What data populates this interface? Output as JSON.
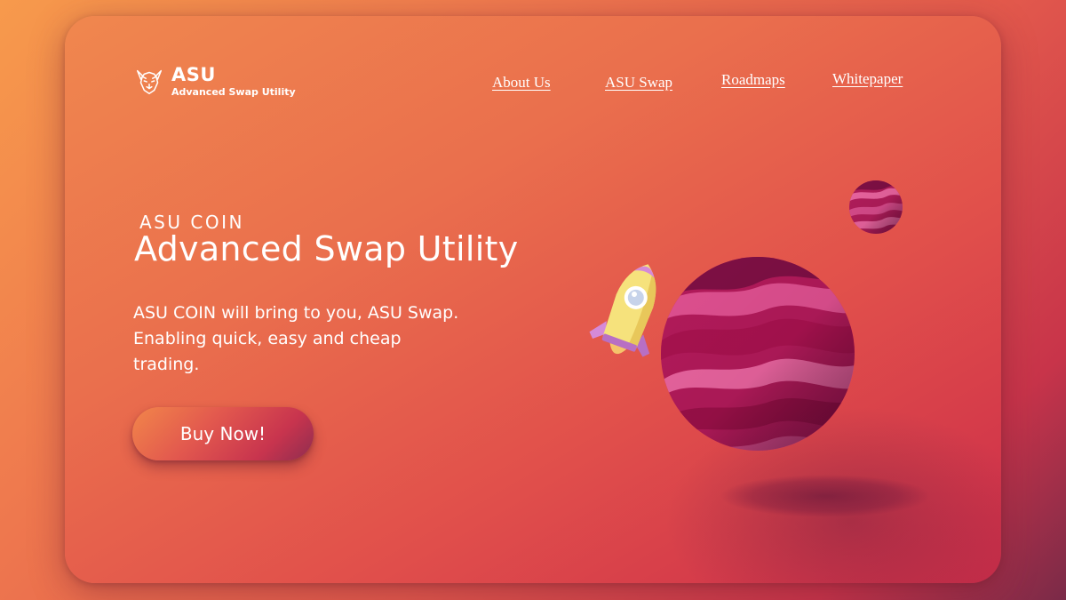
{
  "brand": {
    "name": "ASU",
    "tagline": "Advanced Swap Utility",
    "logo_icon": "dog-face-icon"
  },
  "nav": [
    {
      "label": "About Us"
    },
    {
      "label": "ASU Swap"
    },
    {
      "label": "Roadmaps"
    },
    {
      "label": "Whitepaper"
    }
  ],
  "hero": {
    "kicker": "ASU COIN",
    "title": "Advanced Swap Utility",
    "description": "ASU COIN  will bring to you, ASU Swap. Enabling quick, easy and cheap trading.",
    "cta_label": "Buy Now!"
  },
  "illustration": {
    "rocket": "rocket-icon",
    "large_planet": "planet-icon",
    "small_planet": "small-planet-icon"
  },
  "colors": {
    "background_start": "#f79a4c",
    "background_end": "#7a2a48",
    "planet_dark": "#8a1248",
    "planet_light": "#e8639e",
    "rocket_body": "#f6e27c",
    "rocket_fins": "#d58ad8"
  }
}
